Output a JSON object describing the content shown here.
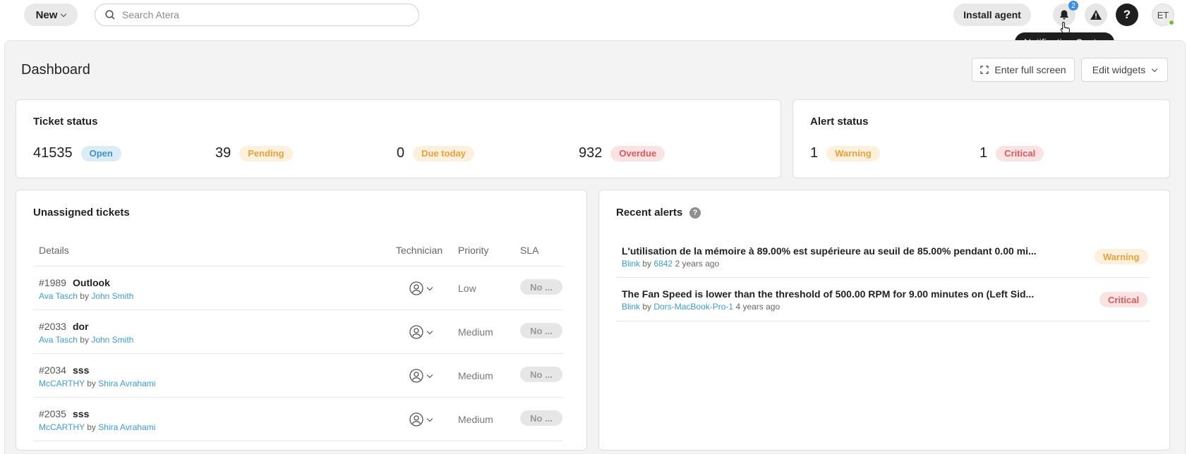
{
  "topbar": {
    "new_label": "New",
    "search_placeholder": "Search Atera",
    "install_label": "Install agent",
    "notification_count": "2",
    "help_label": "?",
    "avatar_initials": "ET",
    "tooltip": "Notification Center"
  },
  "dashboard": {
    "title": "Dashboard",
    "fullscreen_label": "Enter full screen",
    "edit_widgets_label": "Edit widgets"
  },
  "ticket_status": {
    "title": "Ticket status",
    "stats": [
      {
        "value": "41535",
        "label": "Open"
      },
      {
        "value": "39",
        "label": "Pending"
      },
      {
        "value": "0",
        "label": "Due today"
      },
      {
        "value": "932",
        "label": "Overdue"
      }
    ]
  },
  "alert_status": {
    "title": "Alert status",
    "stats": [
      {
        "value": "1",
        "label": "Warning"
      },
      {
        "value": "1",
        "label": "Critical"
      }
    ]
  },
  "unassigned": {
    "title": "Unassigned tickets",
    "columns": [
      "Details",
      "Technician",
      "Priority",
      "SLA"
    ],
    "rows": [
      {
        "id": "#1989",
        "title": "Outlook",
        "customer": "Ava Tasch",
        "by": "by",
        "author": "John Smith",
        "priority": "Low",
        "sla": "No ..."
      },
      {
        "id": "#2033",
        "title": "dor",
        "customer": "Ava Tasch",
        "by": "by",
        "author": "John Smith",
        "priority": "Medium",
        "sla": "No ..."
      },
      {
        "id": "#2034",
        "title": "sss",
        "customer": "McCARTHY",
        "by": "by",
        "author": "Shira Avrahami",
        "priority": "Medium",
        "sla": "No ..."
      },
      {
        "id": "#2035",
        "title": "sss",
        "customer": "McCARTHY",
        "by": "by",
        "author": "Shira Avrahami",
        "priority": "Medium",
        "sla": "No ..."
      }
    ]
  },
  "recent_alerts": {
    "title": "Recent alerts",
    "help_icon": "?",
    "items": [
      {
        "title": "L'utilisation de la mémoire à 89.00% est supérieure au seuil de 85.00% pendant 0.00 mi...",
        "customer": "Blink",
        "by": "by",
        "device": "6842",
        "time": "2 years ago",
        "severity": "Warning"
      },
      {
        "title": "The Fan Speed is lower than the threshold of 500.00 RPM for 9.00 minutes on (Left Sid...",
        "customer": "Blink",
        "by": "by",
        "device": "Dors-MacBook-Pro-1",
        "time": "4 years ago",
        "severity": "Critical"
      }
    ]
  }
}
